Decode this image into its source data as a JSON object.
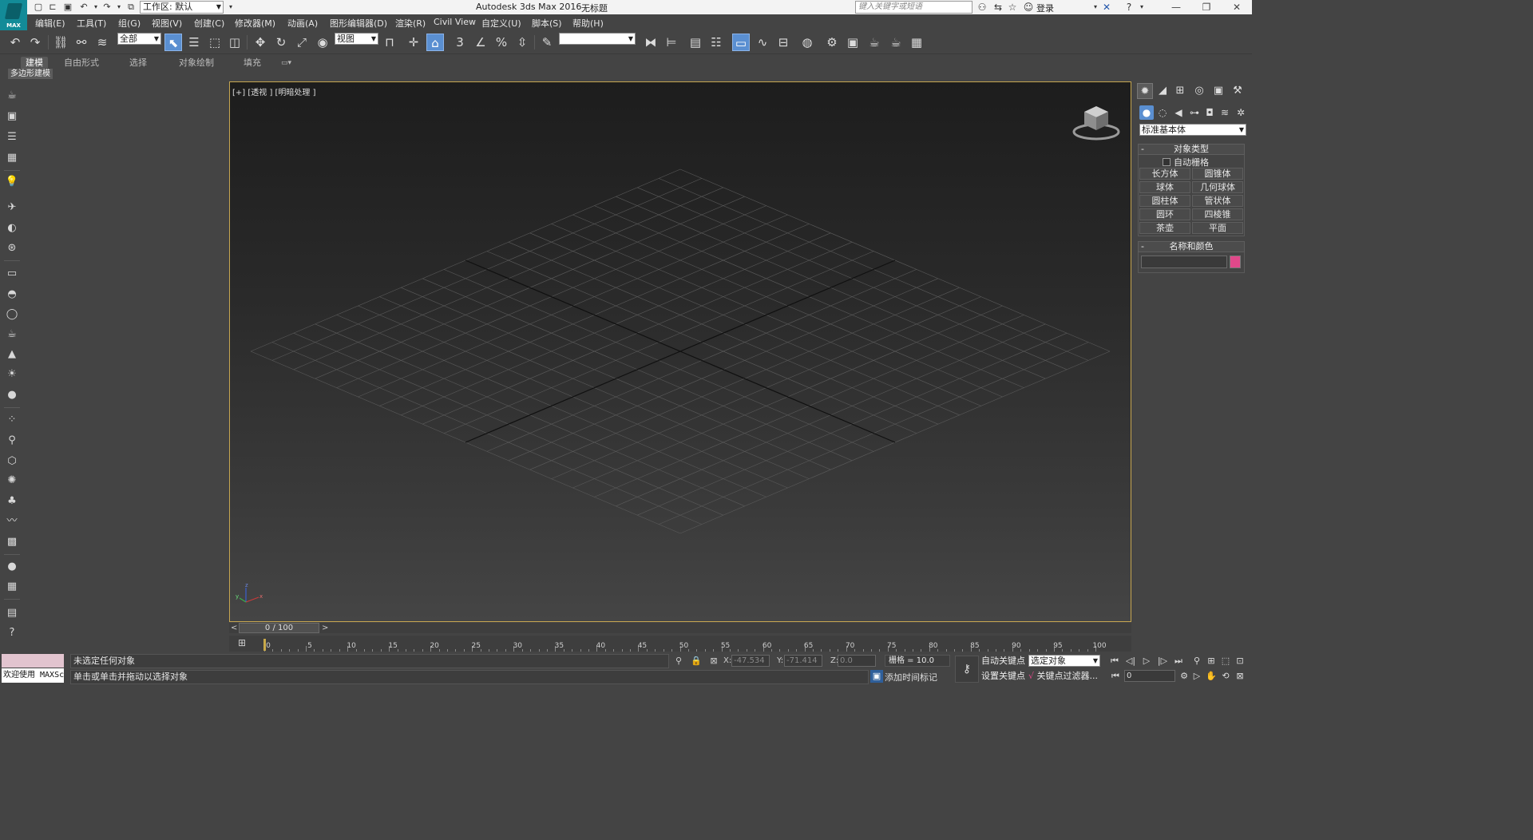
{
  "titlebar": {
    "logo_text": "MAX",
    "workspace": "工作区: 默认",
    "app_title": "Autodesk 3ds Max 2016",
    "doc_title": "无标题",
    "search_placeholder": "键入关键字或短语",
    "login": "登录"
  },
  "menu": [
    "编辑(E)",
    "工具(T)",
    "组(G)",
    "视图(V)",
    "创建(C)",
    "修改器(M)",
    "动画(A)",
    "图形编辑器(D)",
    "渲染(R)",
    "Civil View",
    "自定义(U)",
    "脚本(S)",
    "帮助(H)"
  ],
  "toolbar": {
    "selection_filter": "全部",
    "ref_coord": "视图",
    "snap_3": "3",
    "percent_snap": "%",
    "named_selection": ""
  },
  "ribbon": {
    "tabs": [
      "建模",
      "自由形式",
      "选择",
      "对象绘制",
      "填充"
    ],
    "active_tab": "建模",
    "panel": "多边形建模"
  },
  "viewport": {
    "label": "[+] [透视 ] [明暗处理 ]",
    "axis_z": "z",
    "axis_x": "x",
    "axis_y": "y"
  },
  "command_panel": {
    "category": "标准基本体",
    "object_type_title": "对象类型",
    "autogrid": "自动栅格",
    "buttons": [
      "长方体",
      "圆锥体",
      "球体",
      "几何球体",
      "圆柱体",
      "管状体",
      "圆环",
      "四棱锥",
      "茶壶",
      "平面"
    ],
    "name_color_title": "名称和颜色",
    "object_color": "#e0488a"
  },
  "timeline": {
    "left_arrow": "<",
    "position": "0 / 100",
    "right_arrow": ">",
    "ticks": [
      "0",
      "5",
      "10",
      "15",
      "20",
      "25",
      "30",
      "35",
      "40",
      "45",
      "50",
      "55",
      "60",
      "65",
      "70",
      "75",
      "80",
      "85",
      "90",
      "95",
      "100"
    ]
  },
  "status": {
    "maxscript": "欢迎使用 MAXSc",
    "line1": "未选定任何对象",
    "line2": "单击或单击并拖动以选择对象",
    "x_label": "X:",
    "x_value": "-47.534",
    "y_label": "Y:",
    "y_value": "-71.414",
    "z_label": "Z:",
    "z_value": "0.0",
    "grid": "栅格 = 10.0",
    "add_time_tag": "添加时间标记",
    "auto_key": "自动关键点",
    "set_key": "设置关键点",
    "key_target": "选定对象",
    "key_filters": "关键点过滤器...",
    "frame": "0"
  }
}
